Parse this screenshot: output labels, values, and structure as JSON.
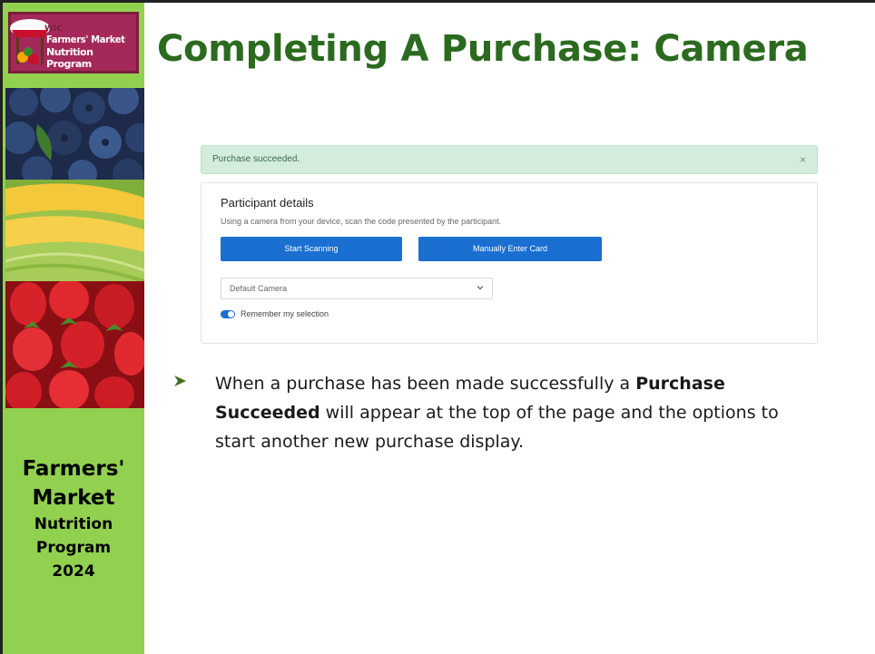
{
  "logo": {
    "wic": "WIC",
    "line1": "Farmers' Market",
    "line2": "Nutrition Program"
  },
  "sidebar": {
    "line1": "Farmers'",
    "line2": "Market",
    "line3": "Nutrition",
    "line4": "Program",
    "line5": "2024"
  },
  "title": "Completing A Purchase: Camera",
  "app": {
    "alert_text": "Purchase succeeded.",
    "alert_close": "×",
    "card_title": "Participant details",
    "card_desc": "Using a camera from your device, scan the code presented by the participant.",
    "start_scanning": "Start Scanning",
    "manual_entry": "Manually Enter Card",
    "camera_select": "Default Camera",
    "remember_toggle_on": true,
    "remember_label": "Remember my selection"
  },
  "bullet": {
    "part1": "When a purchase has been made successfully a ",
    "bold": "Purchase Succeeded",
    "part2": " will appear at the top of the page and the options to start another new purchase display."
  },
  "colors": {
    "sidebar_green": "#92d050",
    "title_green": "#2b6a1f",
    "button_blue": "#1a6fd1",
    "alert_bg": "#d4ecdc"
  }
}
